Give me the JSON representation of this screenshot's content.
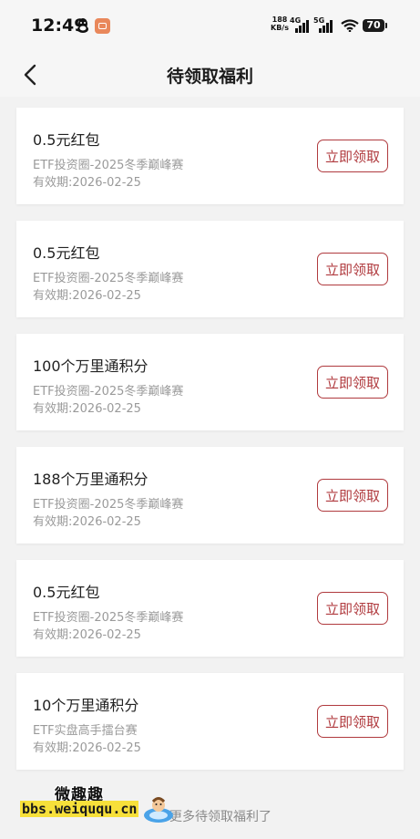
{
  "status_bar": {
    "time": "12:49",
    "net_speed_value": "188",
    "net_speed_unit": "KB/s",
    "signal1_label": "4G",
    "signal2_label": "5G",
    "battery": "70"
  },
  "header": {
    "title": "待领取福利"
  },
  "rewards": [
    {
      "title": "0.5元红包",
      "source": "ETF投资圈-2025冬季巅峰赛",
      "expiry": "有效期:2026-02-25",
      "button": "立即领取"
    },
    {
      "title": "0.5元红包",
      "source": "ETF投资圈-2025冬季巅峰赛",
      "expiry": "有效期:2026-02-25",
      "button": "立即领取"
    },
    {
      "title": "100个万里通积分",
      "source": "ETF投资圈-2025冬季巅峰赛",
      "expiry": "有效期:2026-02-25",
      "button": "立即领取"
    },
    {
      "title": "188个万里通积分",
      "source": "ETF投资圈-2025冬季巅峰赛",
      "expiry": "有效期:2026-02-25",
      "button": "立即领取"
    },
    {
      "title": "0.5元红包",
      "source": "ETF投资圈-2025冬季巅峰赛",
      "expiry": "有效期:2026-02-25",
      "button": "立即领取"
    },
    {
      "title": "10个万里通积分",
      "source": "ETF实盘高手擂台赛",
      "expiry": "有效期:2026-02-25",
      "button": "立即领取"
    }
  ],
  "footer": {
    "more_link": "更多待领取福利了"
  },
  "watermark": {
    "name": "微趣趣",
    "url": "bbs.weiququ.cn"
  },
  "colors": {
    "accent": "#b03a3e",
    "background": "#f2f2f2",
    "card": "#ffffff",
    "muted_text": "#9a9a9a"
  }
}
